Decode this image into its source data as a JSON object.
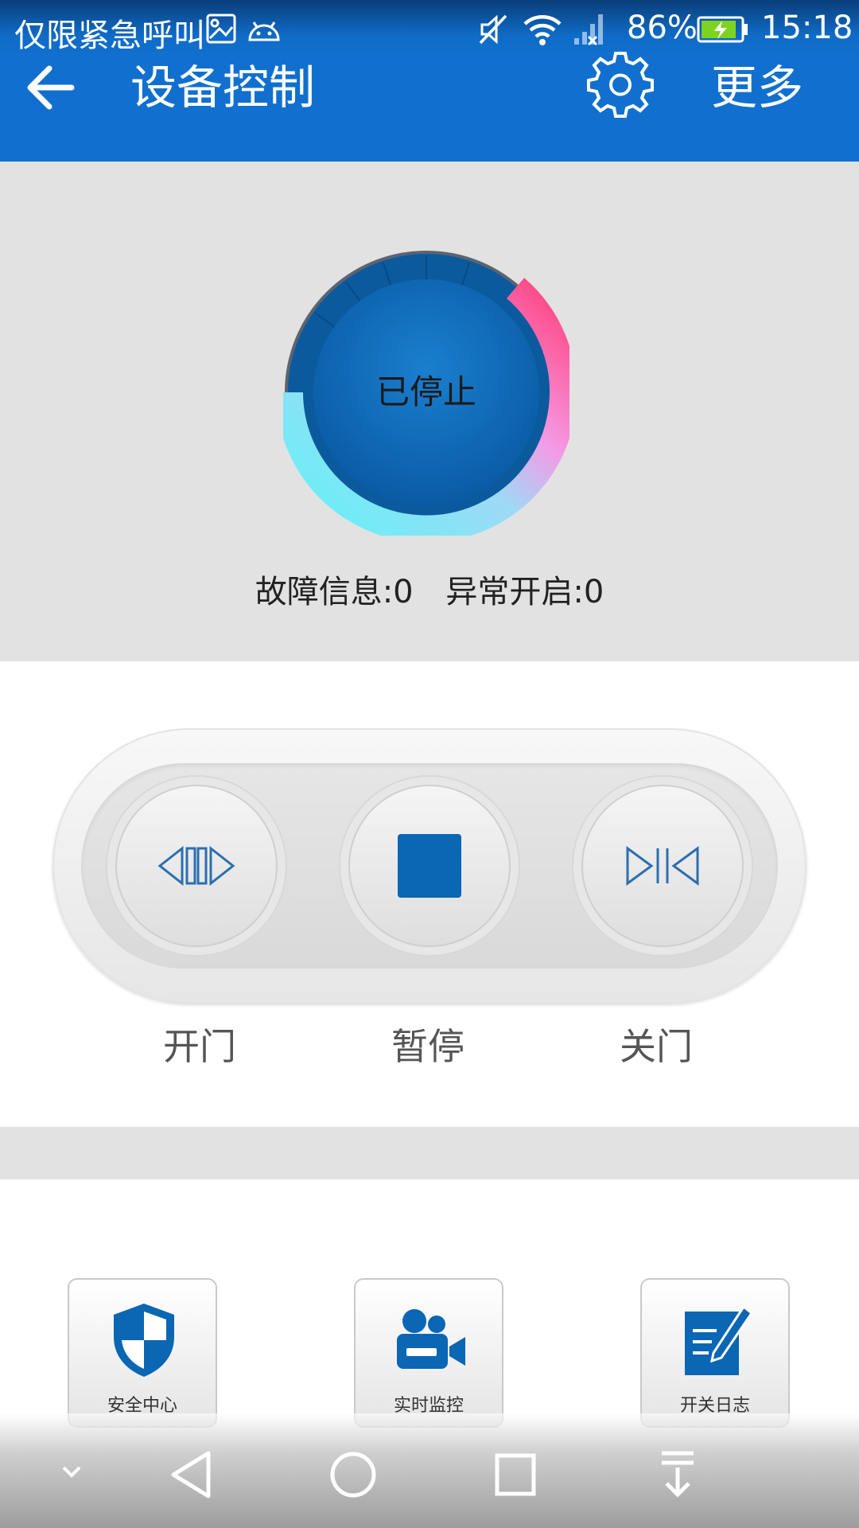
{
  "status_bar": {
    "carrier": "仅限紧急呼叫",
    "battery_percent": "86%",
    "time": "15:18",
    "icons": [
      "image-icon",
      "android-icon",
      "mute-icon",
      "wifi-icon",
      "signal-no-sim-icon",
      "battery-charging-icon"
    ]
  },
  "app_bar": {
    "back_icon": "arrow-left-icon",
    "title": "设备控制",
    "settings_icon": "gear-icon",
    "more": "更多"
  },
  "device_status": {
    "state": "已停止",
    "fault_info": "故障信息:0",
    "abnormal_open": "异常开启:0"
  },
  "controls": {
    "open": {
      "label": "开门",
      "icon": "open-door-icon"
    },
    "pause": {
      "label": "暂停",
      "icon": "stop-square-icon"
    },
    "close": {
      "label": "关门",
      "icon": "close-door-icon"
    }
  },
  "shortcuts": [
    {
      "label": "安全中心",
      "icon": "shield-icon"
    },
    {
      "label": "实时监控",
      "icon": "video-camera-icon"
    },
    {
      "label": "开关日志",
      "icon": "log-edit-icon"
    }
  ],
  "nav_bar": {
    "icons": [
      "collapse-chevron-icon",
      "back-triangle-icon",
      "home-circle-icon",
      "recents-square-icon",
      "notification-pull-icon"
    ]
  },
  "colors": {
    "primary": "#1170cf",
    "gauge_blue": "#0d64b0",
    "icon_blue": "#0b66b4"
  }
}
